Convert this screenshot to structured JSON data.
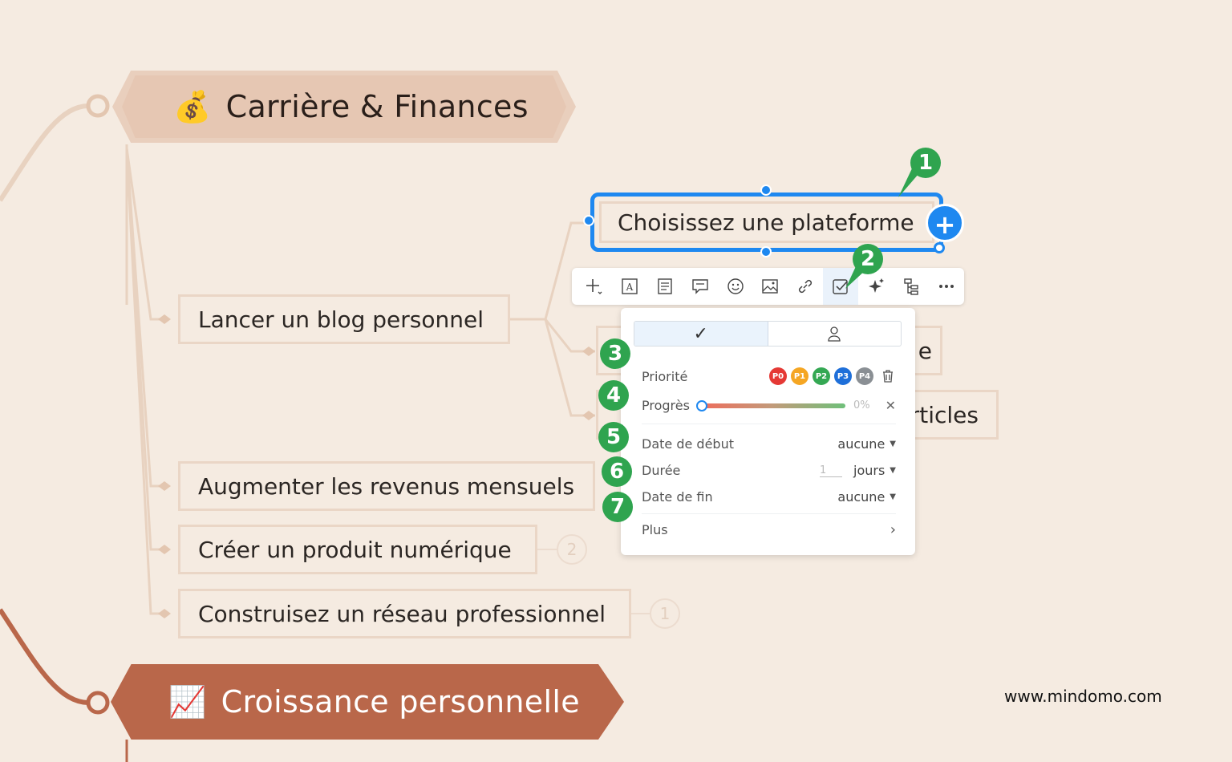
{
  "topics": {
    "main1": {
      "emoji": "💰",
      "label": "Carrière & Finances"
    },
    "main2": {
      "emoji": "📈",
      "label": "Croissance personnelle"
    }
  },
  "subtopics": [
    {
      "label": "Lancer un blog personnel"
    },
    {
      "label": "Augmenter les revenus mensuels"
    },
    {
      "label": "Créer un produit numérique",
      "count": "2"
    },
    {
      "label": "Construisez un réseau professionnel",
      "count": "1"
    }
  ],
  "blog_children": {
    "selected": "Choisissez une plateforme",
    "partial_1": "e",
    "partial_2": "rticles"
  },
  "toolbar": {
    "icons": [
      "add-icon",
      "text-icon",
      "notes-icon",
      "comment-icon",
      "emoji-icon",
      "image-icon",
      "link-icon",
      "task-icon",
      "ai-sparkle-icon",
      "structure-icon",
      "more-icon"
    ]
  },
  "task_panel": {
    "tab_task_icon": "✓",
    "priority_label": "Priorité",
    "priorities": [
      {
        "label": "P0",
        "color": "#e53935"
      },
      {
        "label": "P1",
        "color": "#f5a623"
      },
      {
        "label": "P2",
        "color": "#34a853"
      },
      {
        "label": "P3",
        "color": "#1e6fd9"
      },
      {
        "label": "P4",
        "color": "#8a8f94"
      }
    ],
    "progress_label": "Progrès",
    "progress_value": "0%",
    "progress_fraction": 0,
    "start_label": "Date de début",
    "start_value": "aucune",
    "duration_label": "Durée",
    "duration_value": "1",
    "duration_unit": "jours",
    "end_label": "Date de fin",
    "end_value": "aucune",
    "more_label": "Plus"
  },
  "markers": [
    "1",
    "2",
    "3",
    "4",
    "5",
    "6",
    "7"
  ],
  "colors": {
    "background": "#f5ebe1",
    "selection": "#1e88f0",
    "marker": "#2fa44f",
    "topic1_fill": "#e6c7b3",
    "topic2_fill": "#b9674a"
  },
  "footer": {
    "url": "www.mindomo.com"
  }
}
